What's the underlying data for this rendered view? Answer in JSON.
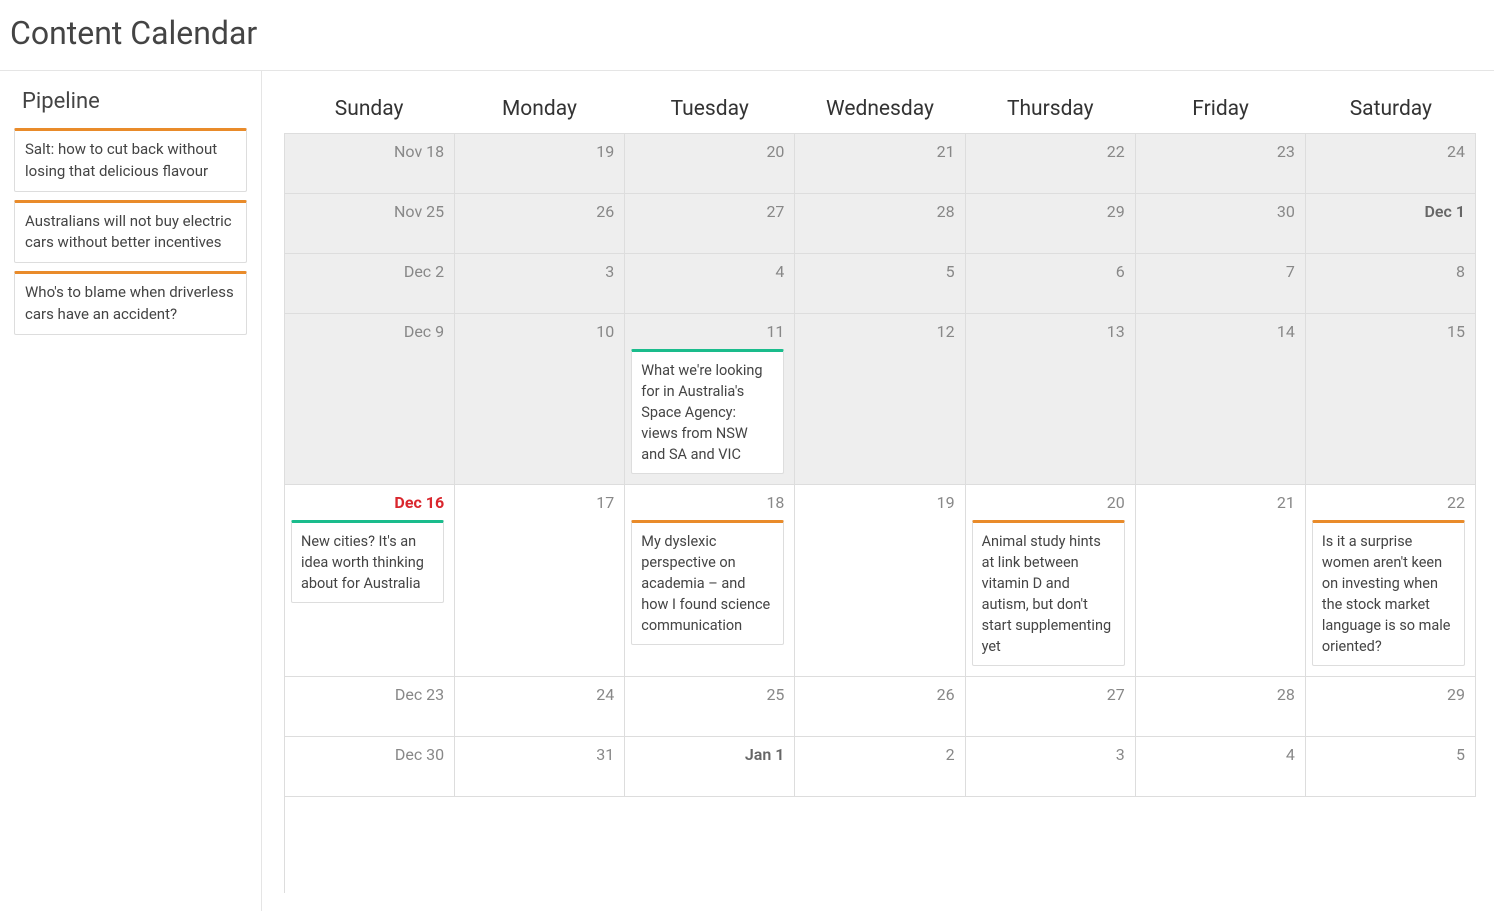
{
  "title": "Content Calendar",
  "sidebar": {
    "heading": "Pipeline",
    "items": [
      {
        "text": "Salt: how to cut back without losing that delicious flavour",
        "color": "orange"
      },
      {
        "text": "Australians will not buy electric cars without better incentives",
        "color": "orange"
      },
      {
        "text": "Who's to blame when driverless cars have an accident?",
        "color": "orange"
      }
    ]
  },
  "weekdays": [
    "Sunday",
    "Monday",
    "Tuesday",
    "Wednesday",
    "Thursday",
    "Friday",
    "Saturday"
  ],
  "weeks": [
    {
      "days": [
        {
          "label": "Nov 18",
          "out": true
        },
        {
          "label": "19",
          "out": true
        },
        {
          "label": "20",
          "out": true
        },
        {
          "label": "21",
          "out": true
        },
        {
          "label": "22",
          "out": true
        },
        {
          "label": "23",
          "out": true
        },
        {
          "label": "24",
          "out": true
        }
      ]
    },
    {
      "days": [
        {
          "label": "Nov 25",
          "out": true
        },
        {
          "label": "26",
          "out": true
        },
        {
          "label": "27",
          "out": true
        },
        {
          "label": "28",
          "out": true
        },
        {
          "label": "29",
          "out": true
        },
        {
          "label": "30",
          "out": true
        },
        {
          "label": "Dec 1",
          "out": true,
          "bold": true
        }
      ]
    },
    {
      "days": [
        {
          "label": "Dec 2",
          "out": true
        },
        {
          "label": "3",
          "out": true
        },
        {
          "label": "4",
          "out": true
        },
        {
          "label": "5",
          "out": true
        },
        {
          "label": "6",
          "out": true
        },
        {
          "label": "7",
          "out": true
        },
        {
          "label": "8",
          "out": true
        }
      ]
    },
    {
      "days": [
        {
          "label": "Dec 9",
          "out": true
        },
        {
          "label": "10",
          "out": true
        },
        {
          "label": "11",
          "out": true,
          "events": [
            {
              "text": "What we're looking for in Australia's Space Agency: views from NSW and SA and VIC",
              "color": "green"
            }
          ]
        },
        {
          "label": "12",
          "out": true
        },
        {
          "label": "13",
          "out": true
        },
        {
          "label": "14",
          "out": true
        },
        {
          "label": "15",
          "out": true
        }
      ]
    },
    {
      "days": [
        {
          "label": "Dec 16",
          "today": true,
          "events": [
            {
              "text": "New cities? It's an idea worth thinking about for Australia",
              "color": "green"
            }
          ]
        },
        {
          "label": "17"
        },
        {
          "label": "18",
          "events": [
            {
              "text": "My dyslexic perspective on academia – and how I found science communication",
              "color": "orange"
            }
          ]
        },
        {
          "label": "19"
        },
        {
          "label": "20",
          "events": [
            {
              "text": "Animal study hints at link between vitamin D and autism, but don't start supplementing yet",
              "color": "orange"
            }
          ]
        },
        {
          "label": "21"
        },
        {
          "label": "22",
          "events": [
            {
              "text": "Is it a surprise women aren't keen on investing when the stock market language is so male oriented?",
              "color": "orange"
            }
          ]
        }
      ]
    },
    {
      "days": [
        {
          "label": "Dec 23"
        },
        {
          "label": "24"
        },
        {
          "label": "25"
        },
        {
          "label": "26"
        },
        {
          "label": "27"
        },
        {
          "label": "28"
        },
        {
          "label": "29"
        }
      ]
    },
    {
      "days": [
        {
          "label": "Dec 30"
        },
        {
          "label": "31"
        },
        {
          "label": "Jan 1",
          "bold": true
        },
        {
          "label": "2"
        },
        {
          "label": "3"
        },
        {
          "label": "4"
        },
        {
          "label": "5"
        }
      ]
    }
  ]
}
